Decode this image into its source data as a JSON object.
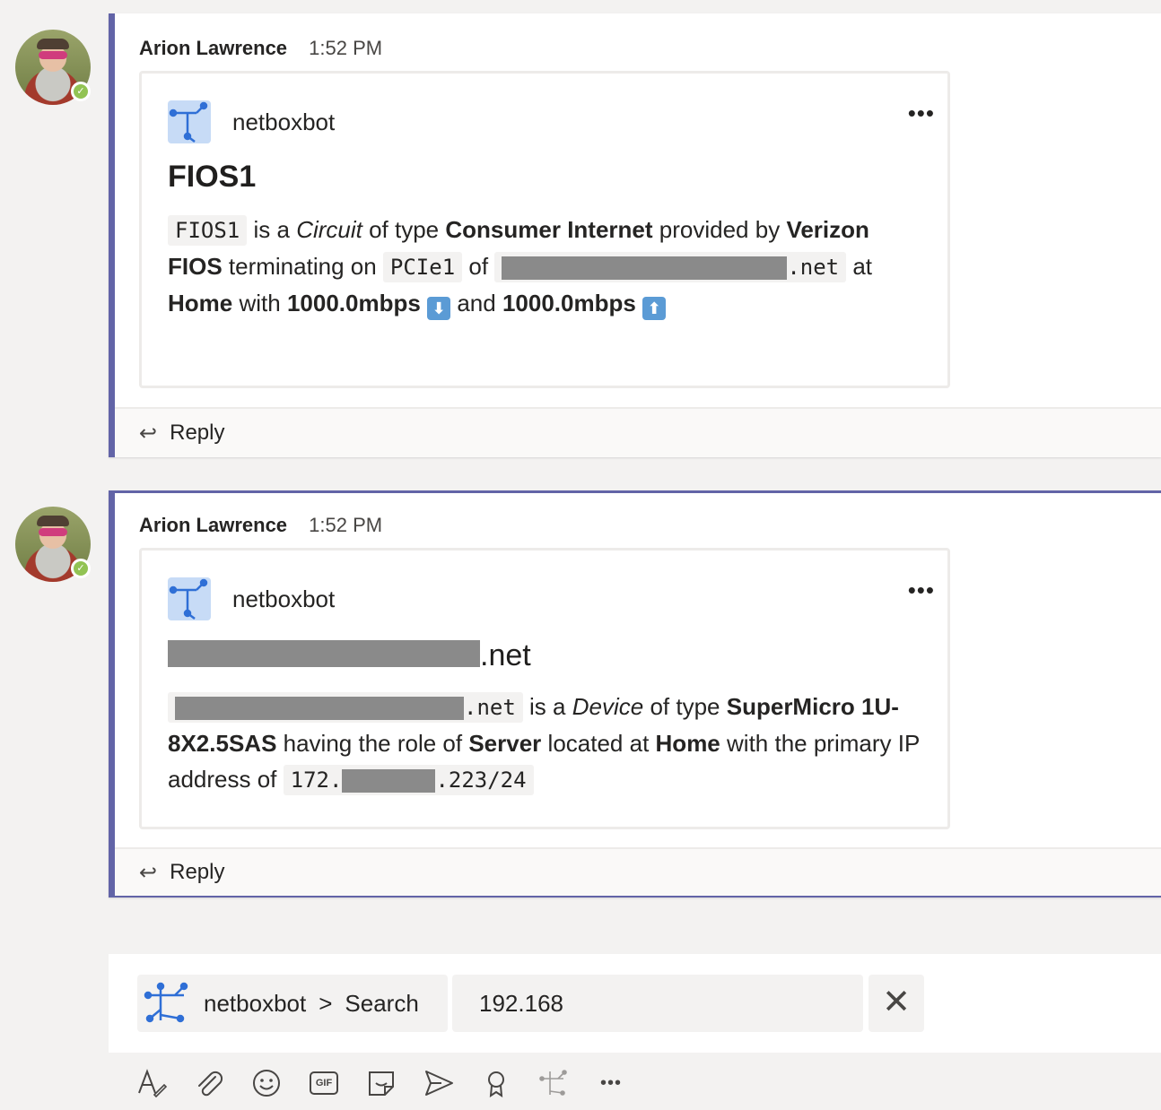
{
  "messages": [
    {
      "sender": "Arion Lawrence",
      "time": "1:52 PM",
      "bot_name": "netboxbot",
      "more_label": "•••",
      "title": "FIOS1",
      "body": {
        "code1": "FIOS1",
        "t1": "is a",
        "type_em": "Circuit",
        "t2": "of type",
        "b1": "Consumer Internet",
        "t3": "provided by",
        "b2": "Verizon FIOS",
        "t4": "terminating on",
        "code2": "PCIe1",
        "t5": "of",
        "code3_suffix": ".net",
        "t6": "at",
        "b3": "Home",
        "t7": "with",
        "b4": "1000.0mbps",
        "down_emoji": "⬇",
        "t8": "and",
        "b5": "1000.0mbps",
        "up_emoji": "⬆"
      },
      "reply_label": "Reply"
    },
    {
      "sender": "Arion Lawrence",
      "time": "1:52 PM",
      "bot_name": "netboxbot",
      "more_label": "•••",
      "title_suffix": ".net",
      "body": {
        "code1_suffix": ".net",
        "t1": "is a",
        "type_em": "Device",
        "t2": "of type",
        "b1": "SuperMicro 1U-8X2.5SAS",
        "t3": "having the role of",
        "b2": "Server",
        "t4": "located at",
        "b3": "Home",
        "t5": "with the primary IP address of",
        "ip_prefix": "172.",
        "ip_suffix": ".223/24"
      },
      "reply_label": "Reply"
    }
  ],
  "composer": {
    "bot_name": "netboxbot",
    "separator": ">",
    "command": "Search",
    "query": "192.168",
    "clear_label": "✕"
  },
  "toolbar": {
    "more_label": "•••",
    "gif_label": "GIF"
  },
  "colors": {
    "accent": "#6264a7",
    "presence": "#92c353",
    "background": "#f3f2f1"
  }
}
